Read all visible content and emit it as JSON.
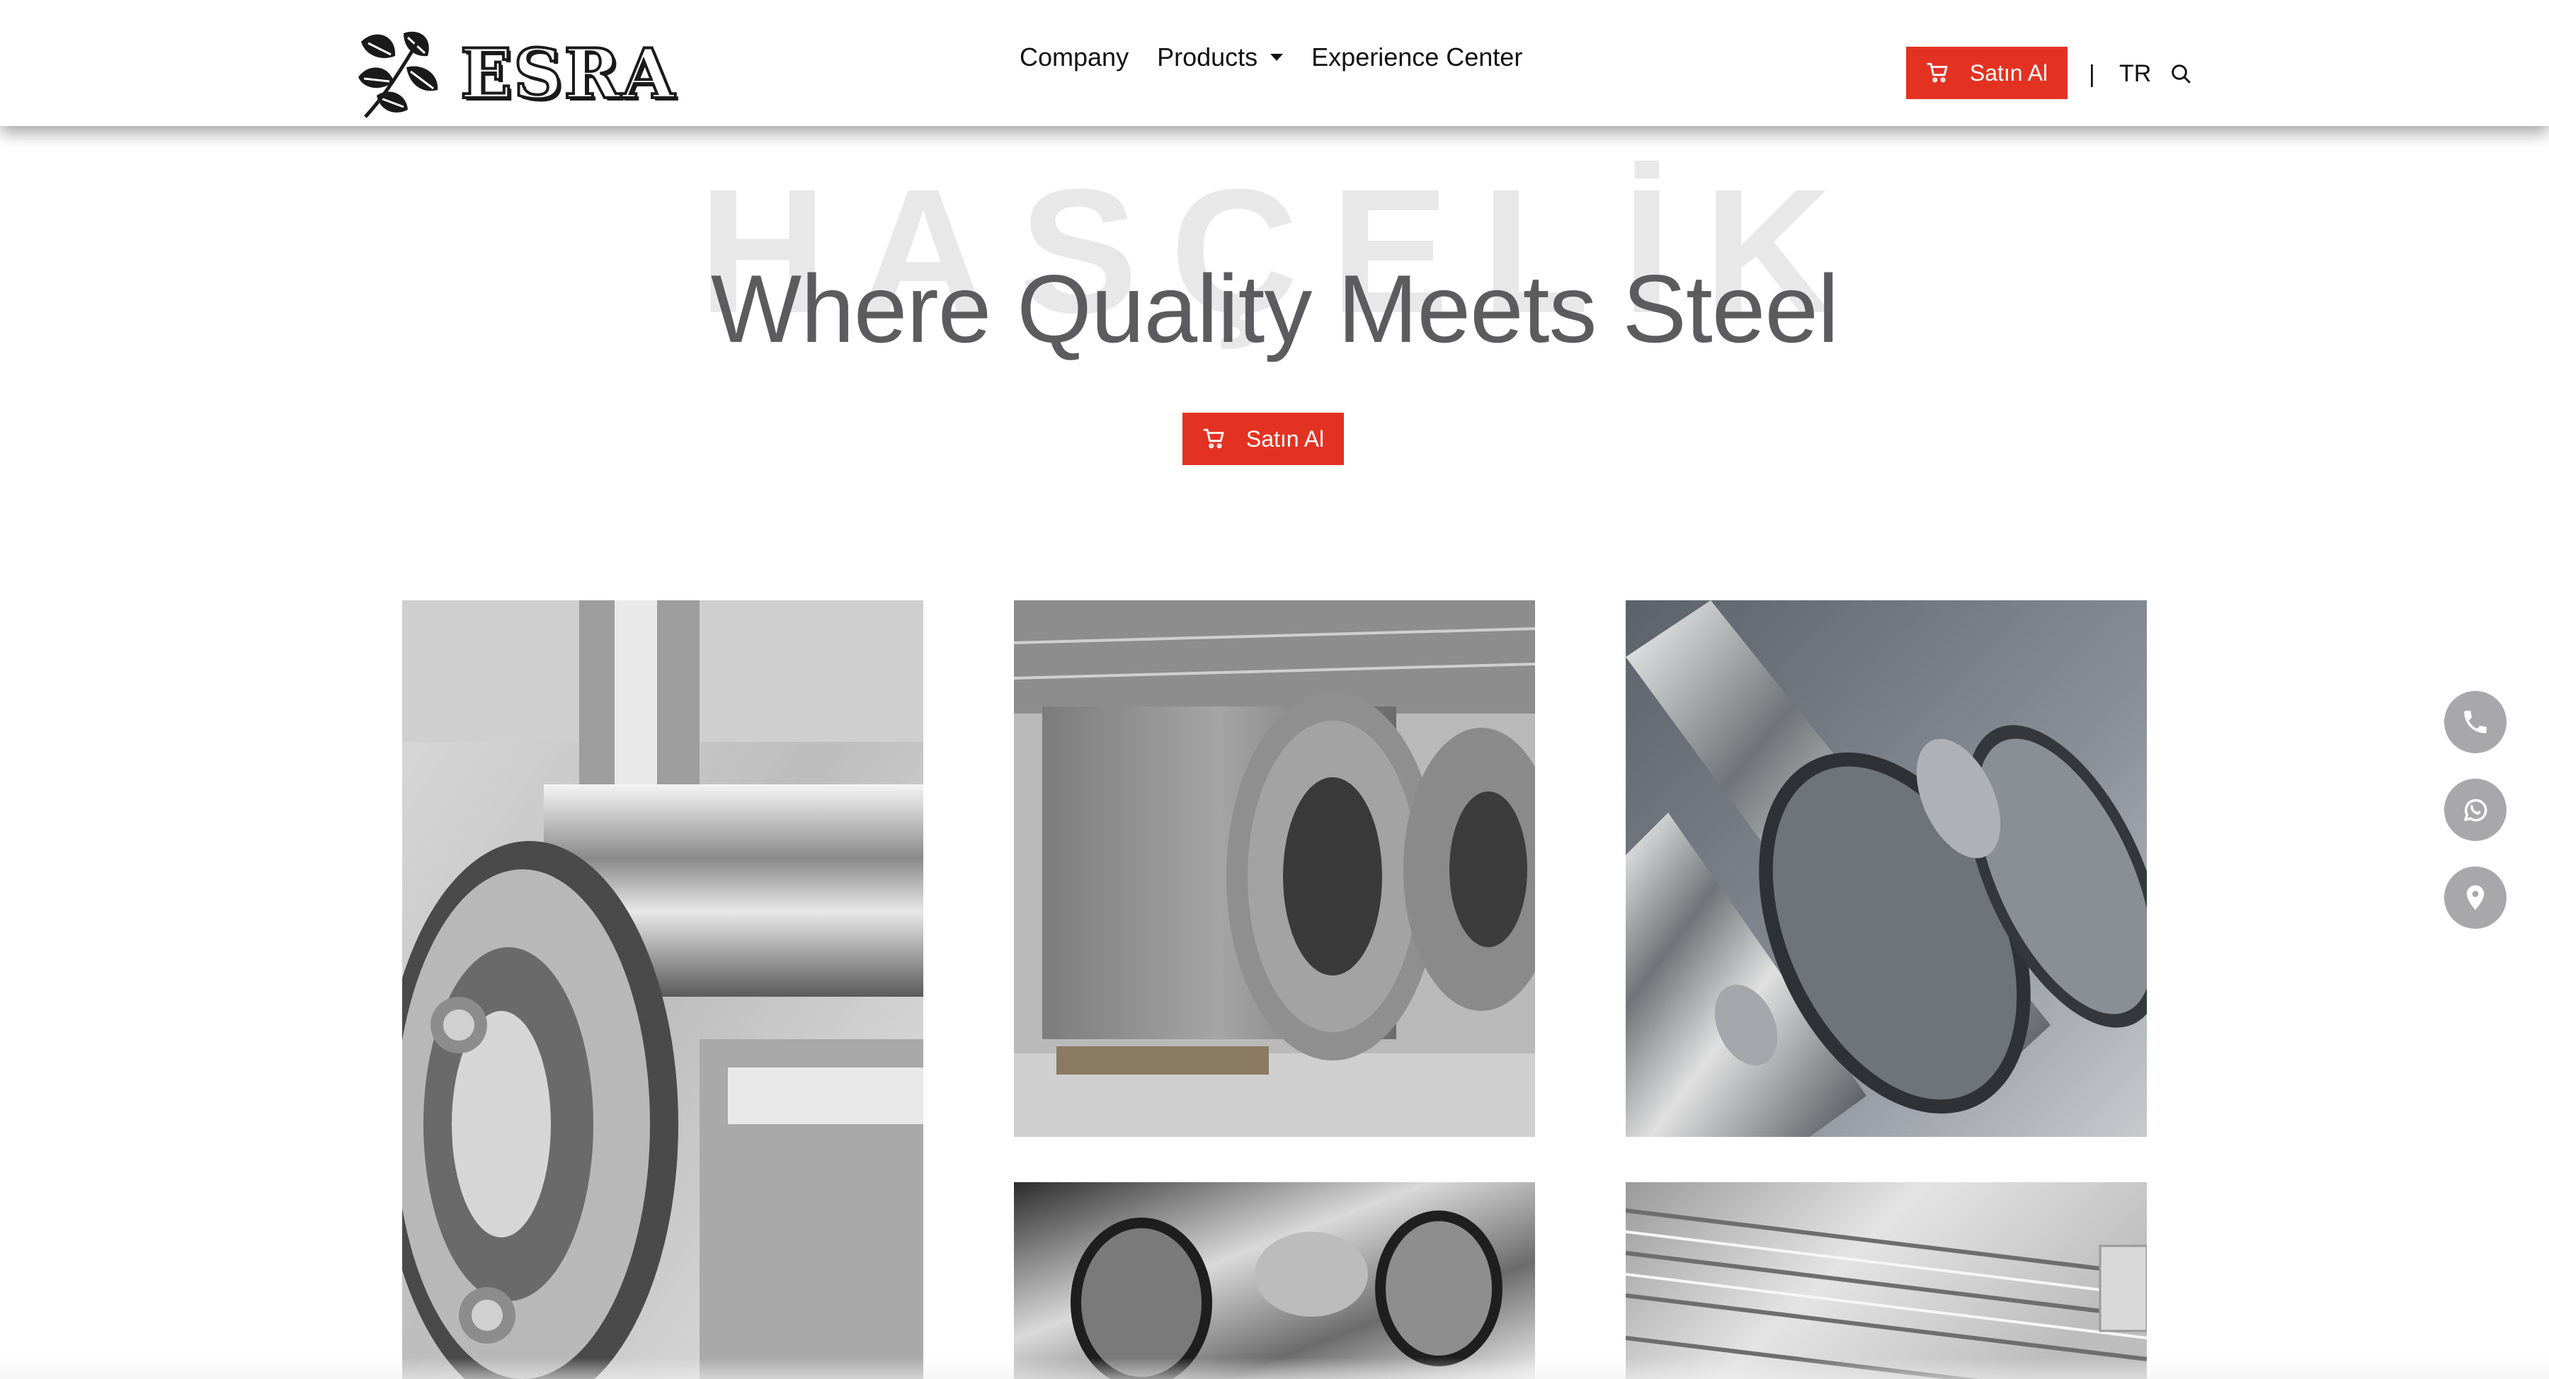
{
  "header": {
    "brand": "ESRA",
    "nav": [
      {
        "label": "Company"
      },
      {
        "label": "Products"
      },
      {
        "label": "Experience Center"
      }
    ],
    "buy_label": "Satın Al",
    "separator": "|",
    "lang": "TR"
  },
  "hero": {
    "watermark": "HASÇELİK",
    "title": "Where Quality Meets Steel",
    "buy_label": "Satın Al"
  },
  "gallery": [
    {
      "subject": "stainless steel flange and pipe assembly"
    },
    {
      "subject": "steel coils in warehouse"
    },
    {
      "subject": "polished stainless steel tubes"
    },
    {
      "subject": "stainless steel pipes"
    },
    {
      "subject": "stainless steel square bars"
    }
  ],
  "floating_contacts": [
    {
      "icon": "phone-icon"
    },
    {
      "icon": "whatsapp-icon"
    },
    {
      "icon": "location-pin-icon"
    }
  ],
  "colors": {
    "accent": "#e43222",
    "title": "#5c5c5e",
    "fab": "#a8a8aa"
  }
}
